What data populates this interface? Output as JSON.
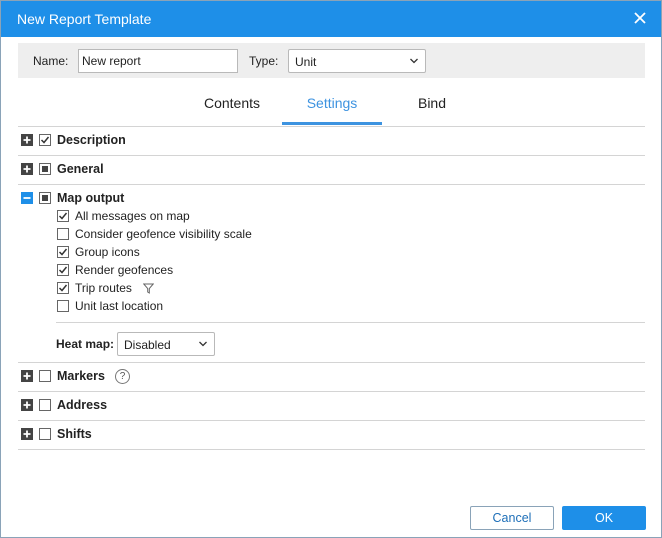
{
  "dialog": {
    "title": "New Report Template"
  },
  "form": {
    "name_label": "Name:",
    "name_value": "New report",
    "type_label": "Type:",
    "type_value": "Unit"
  },
  "tabs": [
    {
      "label": "Contents",
      "active": false
    },
    {
      "label": "Settings",
      "active": true
    },
    {
      "label": "Bind",
      "active": false
    }
  ],
  "sections": {
    "description": {
      "title": "Description",
      "expanded": false,
      "checked": "checked"
    },
    "general": {
      "title": "General",
      "expanded": false,
      "checked": "partial"
    },
    "map_output": {
      "title": "Map output",
      "expanded": true,
      "checked": "partial",
      "options": [
        {
          "label": "All messages on map",
          "checked": true
        },
        {
          "label": "Consider geofence visibility scale",
          "checked": false
        },
        {
          "label": "Group icons",
          "checked": true
        },
        {
          "label": "Render geofences",
          "checked": true
        },
        {
          "label": "Trip routes",
          "checked": true
        },
        {
          "label": "Unit last location",
          "checked": false
        }
      ],
      "heat_map_label": "Heat map:",
      "heat_map_value": "Disabled"
    },
    "markers": {
      "title": "Markers",
      "expanded": false,
      "checked": "unchecked"
    },
    "address": {
      "title": "Address",
      "expanded": false,
      "checked": "unchecked"
    },
    "shifts": {
      "title": "Shifts",
      "expanded": false,
      "checked": "unchecked"
    }
  },
  "footer": {
    "cancel_label": "Cancel",
    "ok_label": "OK"
  },
  "colors": {
    "accent": "#1e8fe8",
    "tab_active": "#3d93e0"
  },
  "icons": {
    "close": "close-icon",
    "expand": "plus-icon",
    "collapse": "minus-icon",
    "filter": "filter-icon",
    "help": "help-icon",
    "dropdown": "chevron-down-icon"
  }
}
